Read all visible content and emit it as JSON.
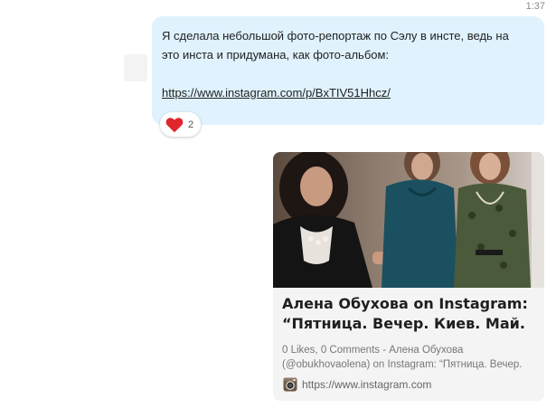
{
  "chat": {
    "timestamp": "1:37",
    "message": {
      "text": "Я сделала небольшой фото-репортаж по Сэлу в инсте, ведь на\nэто инста и придумана, как фото-альбом:",
      "link": "https://www.instagram.com/p/BxTIV51Hhcz/",
      "bubble_color": "#dff2fd"
    },
    "reaction": {
      "icon": "heart-icon",
      "color": "#e0262c",
      "count": "2"
    },
    "link_preview": {
      "title": "Алена Обухова on Instagram:\n“Пятница. Вечер. Киев. Май.",
      "description": "0 Likes, 0 Comments - Алена Обухова\n(@obukhovaolena) on Instagram: “Пятница. Вечер.",
      "source_icon": "instagram-icon",
      "source_url": "https://www.instagram.com"
    }
  }
}
